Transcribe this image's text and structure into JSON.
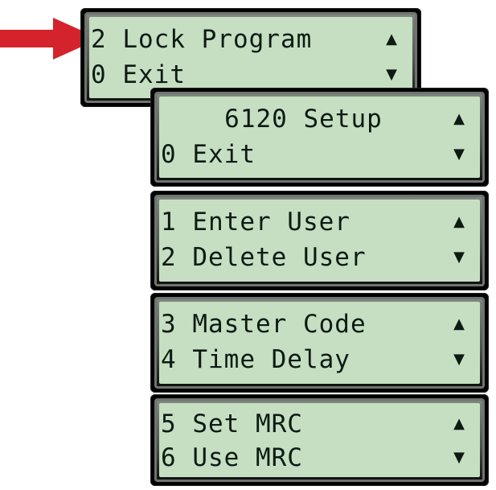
{
  "colors": {
    "arrow": "#d4232c",
    "lcd_bg": "#c6dfc2",
    "lcd_text": "#0d1b14",
    "bezel": "#000000"
  },
  "icons": {
    "up": "▲",
    "down": "▼"
  },
  "screens": [
    {
      "line1": "2 Lock Program",
      "line2": "0 Exit"
    },
    {
      "line1": "6120 Setup",
      "line2": "0 Exit"
    },
    {
      "line1": "1 Enter User",
      "line2": "2 Delete User"
    },
    {
      "line1": "3 Master Code",
      "line2": "4 Time Delay"
    },
    {
      "line1": "5 Set MRC",
      "line2": "6 Use MRC"
    }
  ]
}
